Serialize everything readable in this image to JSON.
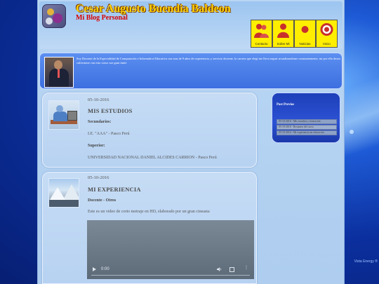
{
  "header": {
    "title": "Cesar Augusto Buendia Baldeon",
    "subtitle": "Mi Blog Personal"
  },
  "nav": [
    {
      "label": "Contacto",
      "icon": "people-icon"
    },
    {
      "label": "Sobre Mi",
      "icon": "person-icon"
    },
    {
      "label": "Noticias",
      "icon": "dot-icon"
    },
    {
      "label": "Inicio",
      "icon": "target-icon"
    }
  ],
  "bio": {
    "text": "Soy Docente de la Especialidad de Computación e Informática Educativa con mas de 9 años de experiencia, y servicio docente, la carrera que elegí me lleva seguir actualizandome constantemente, mi por ello deseo cultivarme con esto curso con gran ímite"
  },
  "posts": [
    {
      "date": "05-10-2016",
      "title": "MIS ESTUDIOS",
      "blocks": [
        {
          "type": "heading",
          "text": "Secundarios:"
        },
        {
          "type": "text",
          "text": "I.E. \"AAA\" - Pasco Perú"
        },
        {
          "type": "heading",
          "text": "Superior:"
        },
        {
          "type": "text",
          "text": "UNIVERSIDAD NACIONAL DANIEL ALCIDES CARRION - Pasco Perú"
        }
      ]
    },
    {
      "date": "05-10-2016",
      "title": "MI EXPERIENCIA",
      "blocks": [
        {
          "type": "heading",
          "text": "Docente - Otros"
        },
        {
          "type": "text",
          "text": "Este es un video de corto metraje en HD, elaborado por un gran cineasta"
        }
      ],
      "video": {
        "time": "0:00"
      }
    }
  ],
  "sidebar": {
    "title": "Post Previos",
    "items": [
      "05-10-2016 - Mis estudios y formación",
      "05-10-2016 - Resumen del curso",
      "05-10-2016 - Mi experiencia en educación"
    ]
  },
  "watermark": "Vista Energy ®",
  "colors": {
    "title": "#ffd400",
    "subtitle": "#d60000",
    "nav": "#ffee00",
    "bio_bg": "#4a7ee8"
  }
}
